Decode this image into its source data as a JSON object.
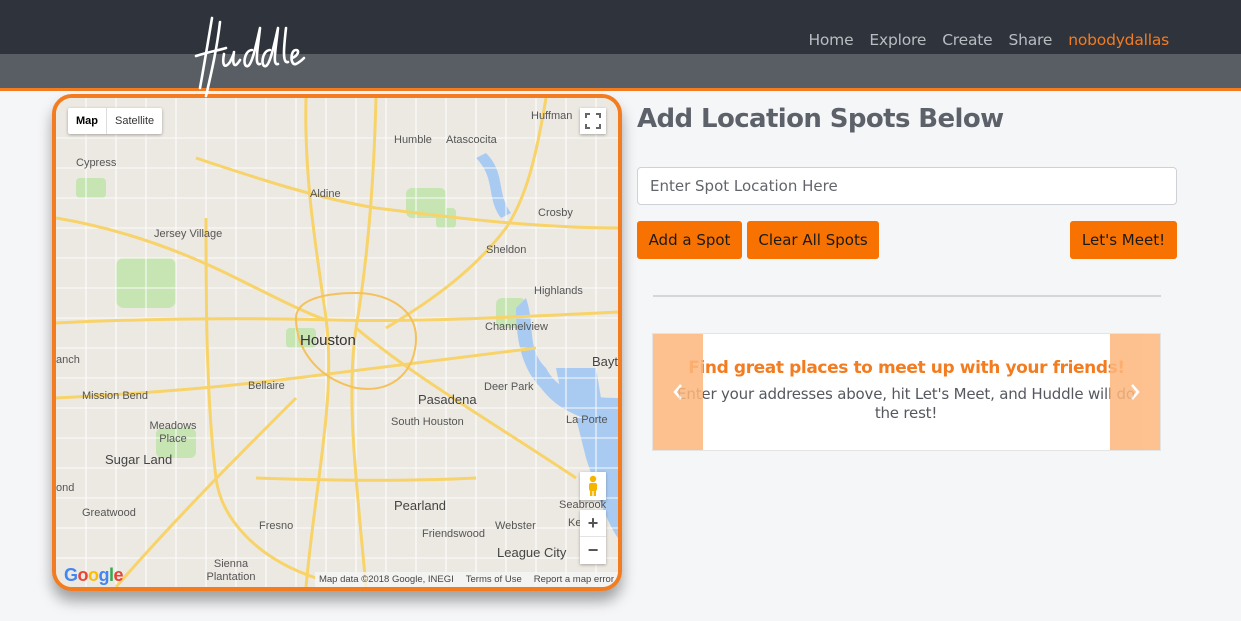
{
  "brand": {
    "logo_text": "Huddle"
  },
  "nav": {
    "items": [
      "Home",
      "Explore",
      "Create",
      "Share"
    ],
    "user": "nobodydallas"
  },
  "map": {
    "type_map": "Map",
    "type_satellite": "Satellite",
    "google": "Google",
    "footer_data": "Map data ©2018 Google, INEGI",
    "footer_terms": "Terms of Use",
    "footer_report": "Report a map error",
    "zoom_in": "+",
    "zoom_out": "−",
    "labels": {
      "houston": "Houston",
      "huffman": "Huffman",
      "humble": "Humble",
      "atascocita": "Atascocita",
      "cypress": "Cypress",
      "aldine": "Aldine",
      "crosby": "Crosby",
      "jersey_village": "Jersey Village",
      "sheldon": "Sheldon",
      "highlands": "Highlands",
      "channelview": "Channelview",
      "anch": "anch",
      "bayt": "Bayt",
      "mission_bend": "Mission Bend",
      "bellaire": "Bellaire",
      "deer_park": "Deer Park",
      "pasadena": "Pasadena",
      "la_porte": "La Porte",
      "meadows_place": "Meadows Place",
      "south_houston": "South Houston",
      "sugar_land": "Sugar Land",
      "ond": "ond",
      "seabrook": "Seabrook",
      "ke": "Ke",
      "greatwood": "Greatwood",
      "pearland": "Pearland",
      "fresno": "Fresno",
      "friendswood": "Friendswood",
      "webster": "Webster",
      "league_city": "League City",
      "sienna_plantation": "Sienna Plantation"
    }
  },
  "panel": {
    "heading": "Add Location Spots Below",
    "input_placeholder": "Enter Spot Location Here",
    "add_button": "Add a Spot",
    "clear_button": "Clear All Spots",
    "meet_button": "Let's Meet!"
  },
  "carousel": {
    "title": "Find great places to meet up with your friends!",
    "text": "Enter your addresses above, hit Let's Meet, and Huddle will do the rest!"
  },
  "colors": {
    "accent": "#f47c20",
    "button": "#f77200",
    "header": "#2f333b",
    "subheader": "#595e65"
  }
}
